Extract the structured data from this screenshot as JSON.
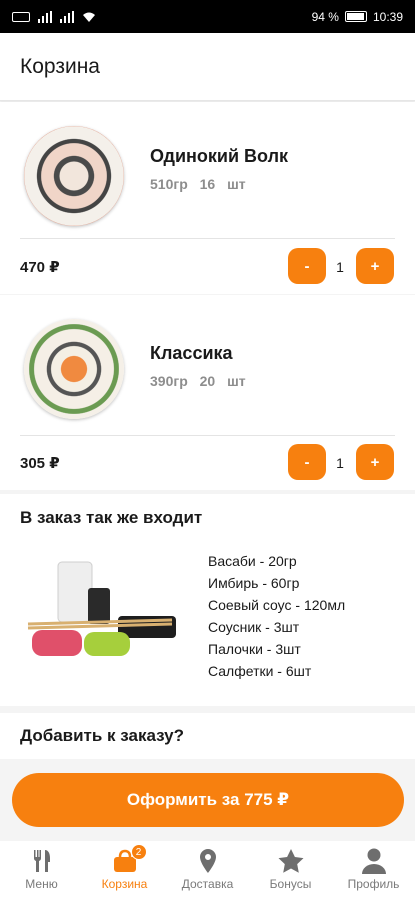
{
  "status_bar": {
    "battery": "94 %",
    "time": "10:39"
  },
  "header": {
    "title": "Корзина"
  },
  "cart": {
    "items": [
      {
        "name": "Одинокий Волк",
        "weight": "510гр",
        "pieces": "16 шт",
        "price": "470 ₽",
        "quantity": "1",
        "minus": "-",
        "plus": "+"
      },
      {
        "name": "Классика",
        "weight": "390гр",
        "pieces": "20 шт",
        "price": "305 ₽",
        "quantity": "1",
        "minus": "-",
        "plus": "+"
      }
    ]
  },
  "extras": {
    "title": "В заказ так же входит",
    "items": [
      "Васаби - 20гр",
      "Имбирь - 60гр",
      "Соевый соус - 120мл",
      "Соусник - 3шт",
      "Палочки - 3шт",
      "Салфетки - 6шт"
    ]
  },
  "add_to_order": {
    "label": "Добавить к заказу?"
  },
  "checkout": {
    "label": "Оформить за 775 ₽"
  },
  "tabs": [
    {
      "label": "Меню",
      "icon": "fork-knife-icon"
    },
    {
      "label": "Корзина",
      "icon": "basket-icon",
      "badge": "2",
      "active": true
    },
    {
      "label": "Доставка",
      "icon": "location-pin-icon"
    },
    {
      "label": "Бонусы",
      "icon": "star-icon"
    },
    {
      "label": "Профиль",
      "icon": "user-icon"
    }
  ],
  "colors": {
    "accent": "#f7800f",
    "inactive": "#7a7a7a"
  }
}
